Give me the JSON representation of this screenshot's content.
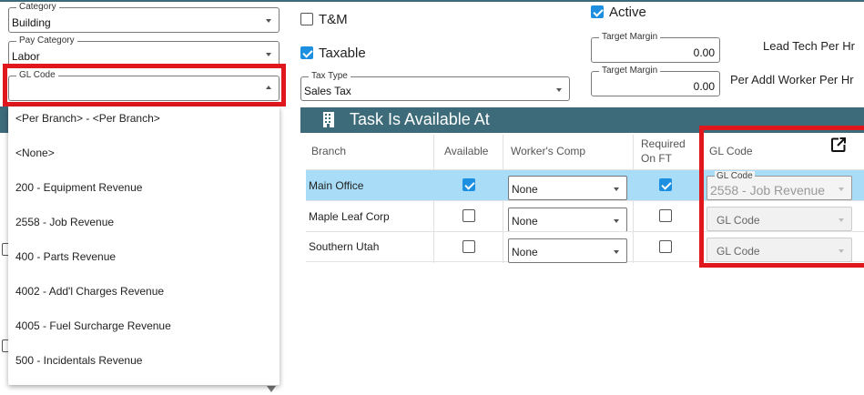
{
  "left_form": {
    "category": {
      "label": "Category",
      "value": "Building"
    },
    "pay_category": {
      "label": "Pay Category",
      "value": "Labor"
    },
    "gl_code": {
      "label": "GL Code",
      "value": ""
    }
  },
  "gl_code_options": [
    "<Per Branch> - <Per Branch>",
    "<None>",
    "200 - Equipment Revenue",
    "2558 - Job Revenue",
    "400 - Parts Revenue",
    "4002 - Add'l Charges Revenue",
    "4005 - Fuel Surcharge Revenue",
    "500 - Incidentals Revenue"
  ],
  "middle_form": {
    "tm": {
      "label": "T&M",
      "checked": false
    },
    "taxable": {
      "label": "Taxable",
      "checked": true
    },
    "tax_type": {
      "label": "Tax Type",
      "value": "Sales Tax"
    }
  },
  "right_form": {
    "active": {
      "label": "Active",
      "checked": true
    },
    "target_margin_1": {
      "label": "Target Margin",
      "value": "0.00"
    },
    "target_margin_2": {
      "label": "Target Margin",
      "value": "0.00"
    },
    "lead_tech_label": "Lead Tech Per Hr",
    "addl_worker_label": "Per Addl Worker Per Hr"
  },
  "section": {
    "title": "Task Is Available At"
  },
  "table": {
    "headers": {
      "branch": "Branch",
      "available": "Available",
      "workers_comp": "Worker's Comp",
      "required_line1": "Required",
      "required_line2": "On FT",
      "gl_code": "GL Code"
    },
    "rows": [
      {
        "branch": "Main Office",
        "available": true,
        "workers_comp": "None",
        "required": true,
        "gl_label": "GL Code",
        "gl_value": "2558 - Job Revenue",
        "selected": true
      },
      {
        "branch": "Maple Leaf Corp",
        "available": false,
        "workers_comp": "None",
        "required": false,
        "gl_label": "",
        "gl_value": "GL Code",
        "selected": false
      },
      {
        "branch": "Southern Utah",
        "available": false,
        "workers_comp": "None",
        "required": false,
        "gl_label": "",
        "gl_value": "GL Code",
        "selected": false
      }
    ]
  },
  "colors": {
    "header_bg": "#3d6b7a",
    "highlight_red": "#e0181d",
    "selected_row": "#a8dcf7",
    "checkbox_blue": "#1c8fe0"
  }
}
